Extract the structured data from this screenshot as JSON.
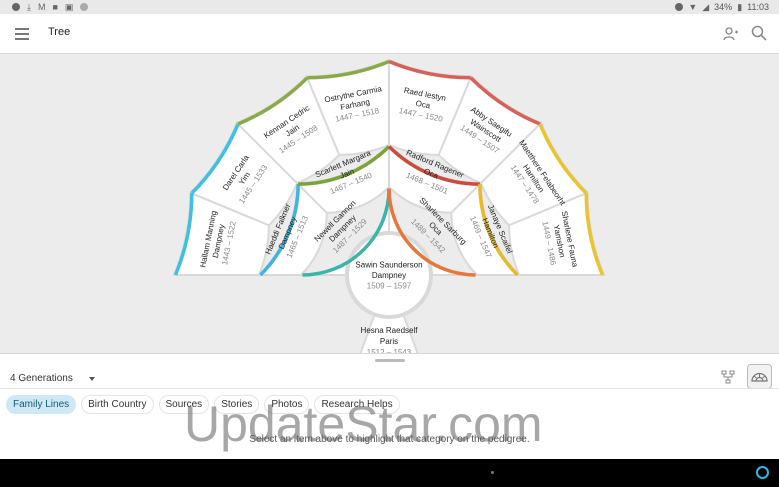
{
  "status_bar": {
    "battery": "34%",
    "time": "11:03",
    "icons": [
      "notification-icon",
      "download-icon",
      "gmail-icon",
      "folder-icon",
      "shopping-bag-icon",
      "circle-icon",
      "do-not-disturb-icon",
      "wifi-icon",
      "signal-icon",
      "battery-icon"
    ]
  },
  "app_bar": {
    "title": "Tree",
    "icons": [
      "menu-icon",
      "person-switch-icon",
      "search-icon"
    ]
  },
  "pedigree": {
    "root": {
      "name_lines": [
        "Sawin Saunderson",
        "Dampney"
      ],
      "dates": "1509 – 1597"
    },
    "generation1": [
      {
        "name_lines": [
          "Newell Gannon",
          "Dampney"
        ],
        "dates": "1487 – 1529",
        "color": "#3bb5a6"
      },
      {
        "name_lines": [
          "Sharlene Sarburg",
          "Oca"
        ],
        "dates": "1489 – 1542",
        "color": "#e8763a"
      }
    ],
    "generation2": [
      {
        "name_lines": [
          "Haeddi Falkner",
          "Dampney"
        ],
        "dates": "1465 – 1513",
        "color": "#3fb5dd"
      },
      {
        "name_lines": [
          "Scarlett Margara",
          "Jain"
        ],
        "dates": "1467 – 1540",
        "color": "#7aa33a"
      },
      {
        "name_lines": [
          "Radford Ragener",
          "Oca"
        ],
        "dates": "1468 – 1501",
        "color": "#cf4a3c"
      },
      {
        "name_lines": [
          "Janaye Scaifel",
          "Hamilton"
        ],
        "dates": "1469 – 1547",
        "color": "#e8b92a"
      }
    ],
    "generation3": [
      {
        "name_lines": [
          "Hallam Manning",
          "Dampney"
        ],
        "dates": "1443 – 1522",
        "color": "#3fc0e0"
      },
      {
        "name_lines": [
          "Darel Carla",
          "Yim"
        ],
        "dates": "1445 – 1533",
        "color": "#3fc0e0"
      },
      {
        "name_lines": [
          "Kennan Cedric",
          "Jain"
        ],
        "dates": "1445 – 1508",
        "color": "#8aaa4a"
      },
      {
        "name_lines": [
          "Ostrythe Carmia",
          "Farhang"
        ],
        "dates": "1447 – 1518",
        "color": "#8aaa4a"
      },
      {
        "name_lines": [
          "Raed Iestyn",
          "Oca"
        ],
        "dates": "1447 – 1520",
        "color": "#d6615a"
      },
      {
        "name_lines": [
          "Abby Saegifu",
          "Wainscott"
        ],
        "dates": "1449 – 1507",
        "color": "#d6615a"
      },
      {
        "name_lines": [
          "Maetthere Felabeorht",
          "Hamilton"
        ],
        "dates": "1447 – 1478",
        "color": "#e8c430"
      },
      {
        "name_lines": [
          "Sharlene Fauna",
          "Yamshon"
        ],
        "dates": "1449 – 1486",
        "color": "#e8c430"
      }
    ],
    "lower": {
      "name_lines": [
        "Hesna Raedself",
        "Paris"
      ],
      "dates": "1512 – 1543",
      "color": "#a04fd0"
    }
  },
  "bottom_panel": {
    "generations_label": "4 Generations",
    "chips": [
      {
        "label": "Family Lines",
        "active": true
      },
      {
        "label": "Birth Country",
        "active": false
      },
      {
        "label": "Sources",
        "active": false
      },
      {
        "label": "Stories",
        "active": false
      },
      {
        "label": "Photos",
        "active": false
      },
      {
        "label": "Research Helps",
        "active": false
      }
    ],
    "hint": "Select an item above to highlight that category on the pedigree."
  },
  "watermark": "UpdateStar.com"
}
